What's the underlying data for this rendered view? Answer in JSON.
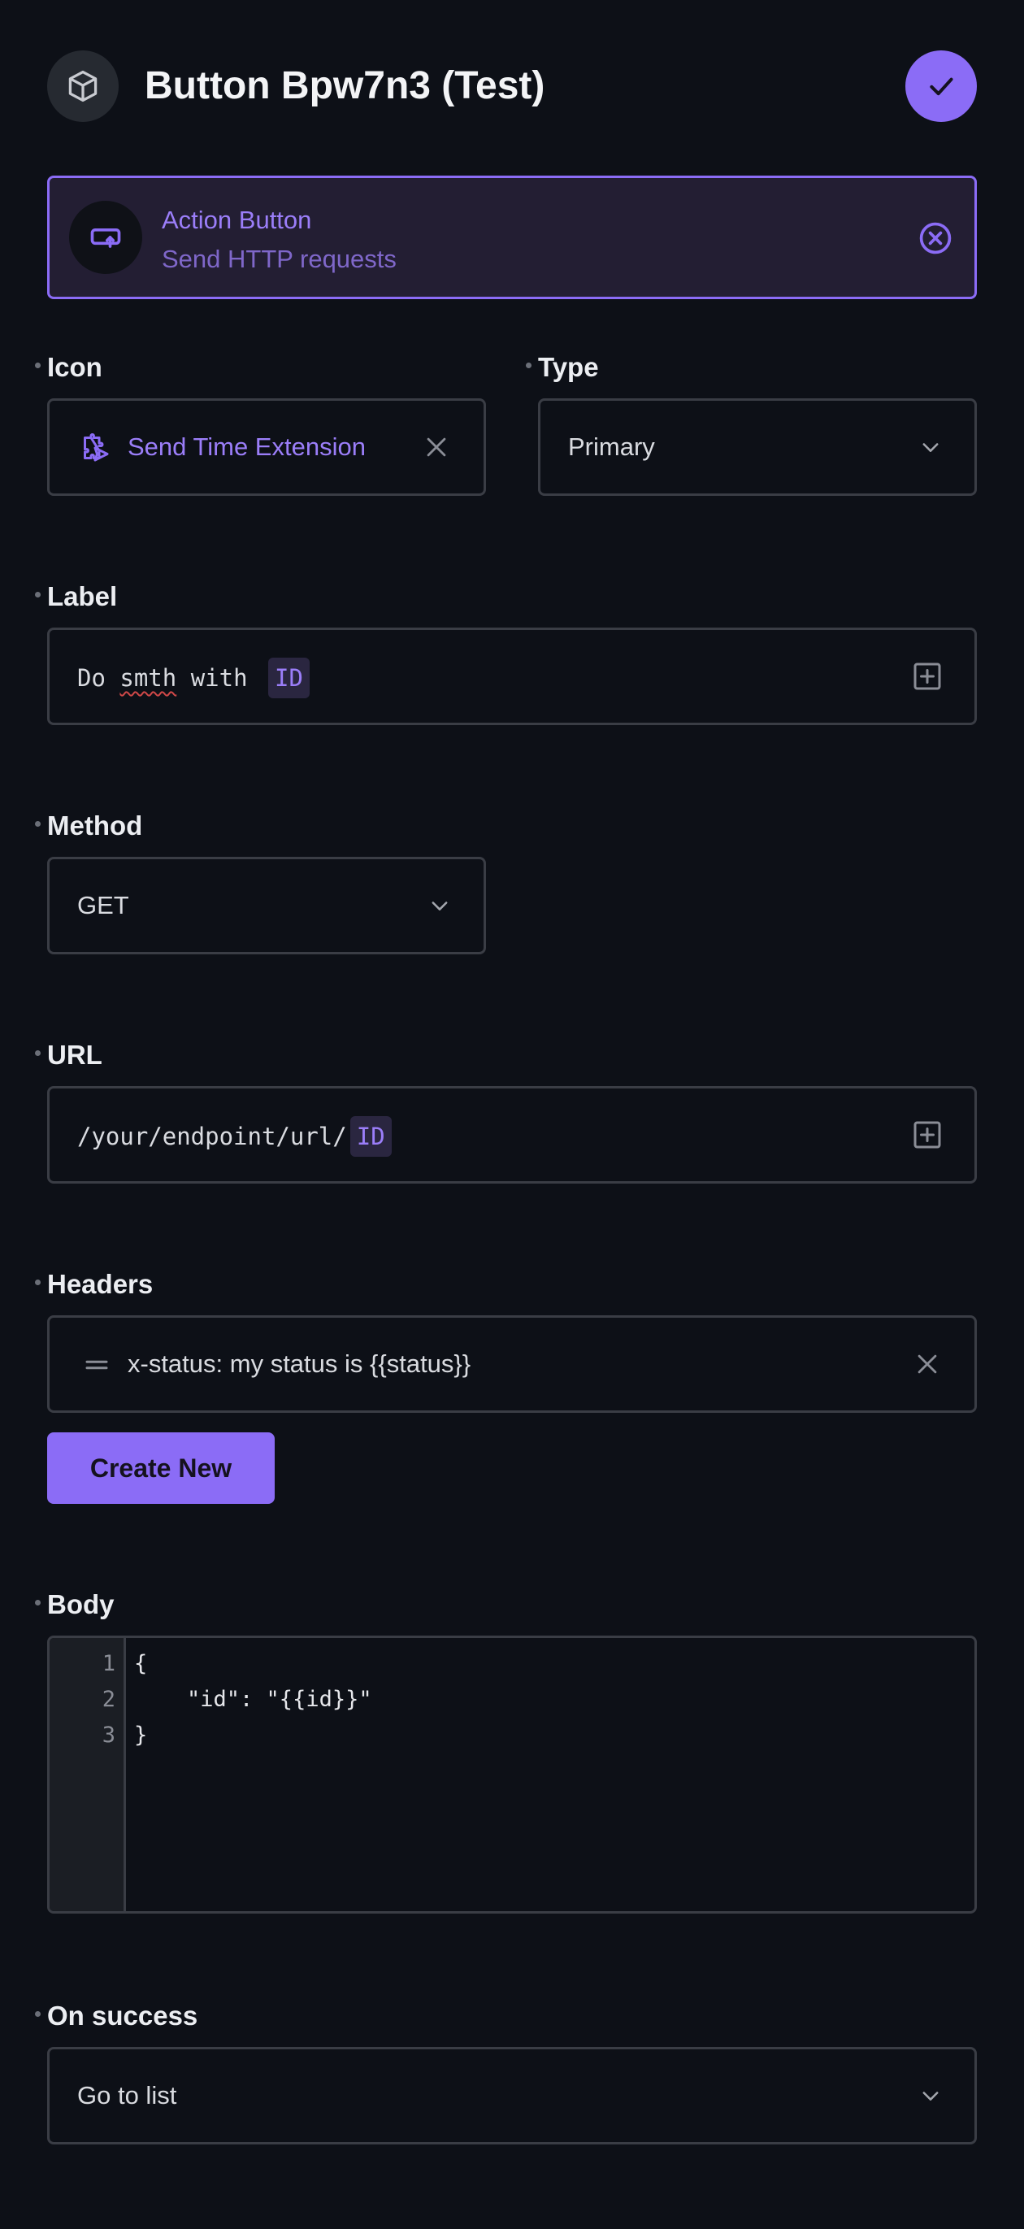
{
  "header": {
    "title": "Button Bpw7n3 (Test)",
    "icon": "cube-icon",
    "confirm_icon": "check-icon"
  },
  "action": {
    "title": "Action Button",
    "subtitle": "Send HTTP requests",
    "icon": "action-button-icon",
    "close_icon": "circle-x-icon"
  },
  "icon_field": {
    "label": "Icon",
    "value": "Send Time Extension",
    "value_icon": "puzzle-send-icon"
  },
  "type_field": {
    "label": "Type",
    "value": "Primary"
  },
  "label_field": {
    "label": "Label",
    "text_plain": "Do ",
    "text_misspelled": "smth",
    "text_after": " with ",
    "tag": "ID"
  },
  "method_field": {
    "label": "Method",
    "value": "GET"
  },
  "url_field": {
    "label": "URL",
    "text": "/your/endpoint/url/",
    "tag": "ID"
  },
  "headers_field": {
    "label": "Headers",
    "items": [
      {
        "value": "x-status: my status is {{status}}"
      }
    ],
    "create_label": "Create New"
  },
  "body_field": {
    "label": "Body",
    "line_numbers": [
      "1",
      "2",
      "3"
    ],
    "lines": [
      "{",
      "    \"id\": \"{{id}}\"",
      "}"
    ]
  },
  "success_field": {
    "label": "On success",
    "value": "Go to list"
  },
  "colors": {
    "accent": "#8b6cf6",
    "background": "#0d1017",
    "border": "#3a3d45"
  }
}
